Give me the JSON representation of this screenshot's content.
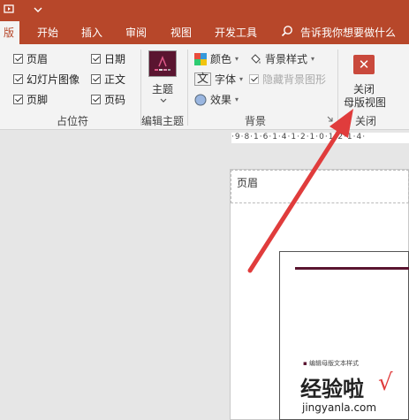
{
  "window": {
    "titlebar_icon": "slideshow-icon"
  },
  "tabs": [
    {
      "label": "版",
      "active": true
    },
    {
      "label": "开始"
    },
    {
      "label": "插入"
    },
    {
      "label": "审阅"
    },
    {
      "label": "视图"
    },
    {
      "label": "开发工具"
    }
  ],
  "search": {
    "placeholder": "告诉我你想要做什么",
    "icon": "search-icon"
  },
  "ribbon": {
    "placeholders_group": {
      "label": "占位符",
      "checkboxes": [
        {
          "label": "页眉",
          "checked": true
        },
        {
          "label": "日期",
          "checked": true
        },
        {
          "label": "幻灯片图像",
          "checked": true
        },
        {
          "label": "正文",
          "checked": true
        },
        {
          "label": "页脚",
          "checked": true
        },
        {
          "label": "页码",
          "checked": true
        }
      ]
    },
    "edit_theme_group": {
      "label": "编辑主题",
      "theme_button": "主题"
    },
    "background_group": {
      "label": "背景",
      "colors": "颜色",
      "fonts": "字体",
      "effects": "效果",
      "bg_styles": "背景样式",
      "hide_bg_graphics": "隐藏背景图形"
    },
    "close_group": {
      "label": "关闭",
      "close_line1": "关闭",
      "close_line2": "母版视图"
    }
  },
  "ruler": {
    "text": "·9·8·1·6·1·4·1·2·1·0·1·2·1·4·"
  },
  "slide": {
    "header_label": "页眉",
    "bullet_text": "编辑母版文本样式"
  },
  "watermark": {
    "line1": "经验啦",
    "check": "√",
    "line2": "jingyanla.com"
  },
  "colors": {
    "accent": "#b7472a",
    "theme_maroon": "#5a1530",
    "arrow": "#e03c3c"
  }
}
